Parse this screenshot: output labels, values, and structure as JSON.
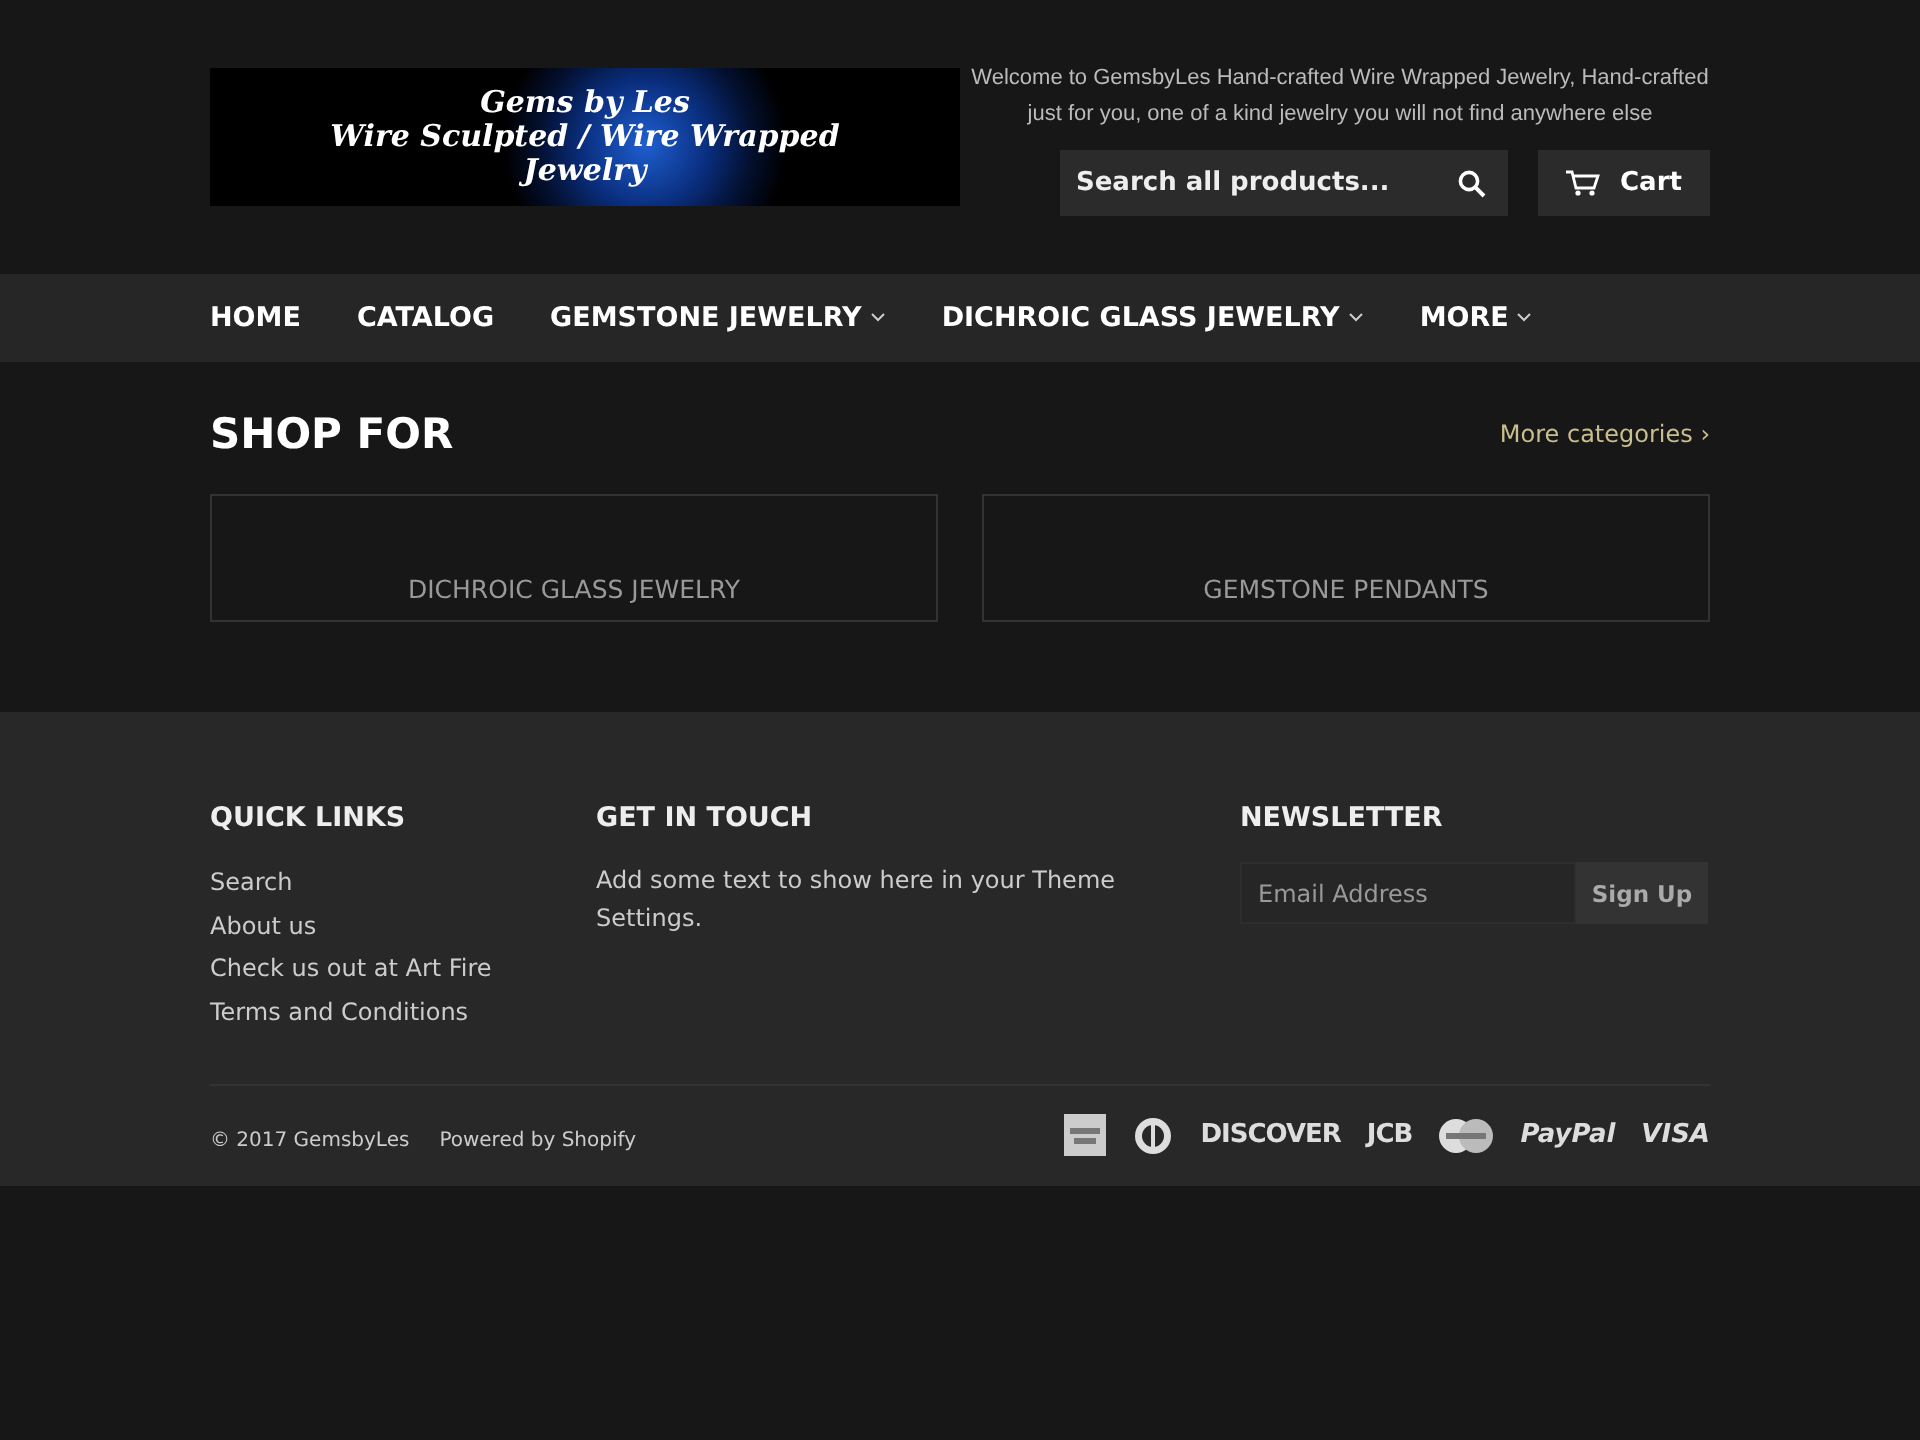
{
  "header": {
    "logo_lines": [
      "Gems by Les",
      "Wire Sculpted / Wire Wrapped",
      "Jewelry"
    ],
    "welcome": "Welcome to GemsbyLes Hand-crafted Wire Wrapped Jewelry, Hand-crafted just for you, one of a kind jewelry you will not find anywhere else",
    "search": {
      "placeholder": "Search all products..."
    },
    "cart": "Cart"
  },
  "nav": [
    {
      "label": "HOME",
      "dropdown": false
    },
    {
      "label": "CATALOG",
      "dropdown": false
    },
    {
      "label": "GEMSTONE JEWELRY",
      "dropdown": true
    },
    {
      "label": "DICHROIC GLASS JEWELRY",
      "dropdown": true
    },
    {
      "label": "MORE",
      "dropdown": true
    }
  ],
  "shop": {
    "title": "SHOP FOR",
    "more": "More categories ›",
    "categories": [
      "DICHROIC GLASS JEWELRY",
      "GEMSTONE PENDANTS"
    ]
  },
  "footer": {
    "quick_links": {
      "title": "QUICK LINKS",
      "links": [
        "Search",
        "About us",
        "Check us out at Art Fire",
        "Terms and Conditions"
      ]
    },
    "get_in_touch": {
      "title": "GET IN TOUCH",
      "text": "Add some text to show here in your Theme Settings."
    },
    "newsletter": {
      "title": "NEWSLETTER",
      "placeholder": "Email Address",
      "button": "Sign Up"
    },
    "copyright": "© 2017 GemsbyLes",
    "powered": "Powered by Shopify",
    "payments": [
      {
        "kind": "amex"
      },
      {
        "kind": "diners"
      },
      {
        "kind": "word",
        "label": "DISCOVER"
      },
      {
        "kind": "word",
        "label": "JCB"
      },
      {
        "kind": "master"
      },
      {
        "kind": "italic",
        "label": "PayPal"
      },
      {
        "kind": "italic",
        "label": "VISA"
      }
    ]
  }
}
